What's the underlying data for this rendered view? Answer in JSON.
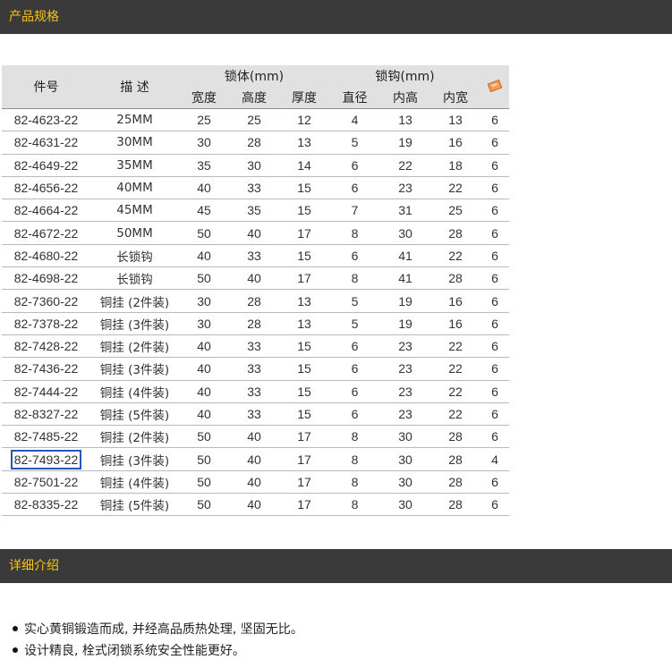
{
  "sections": {
    "spec_title": "产品规格",
    "detail_title": "详细介绍"
  },
  "table": {
    "headers": {
      "part_no": "件号",
      "desc": "描 述",
      "lock_body": "锁体(mm)",
      "shackle": "锁钩(mm)",
      "width": "宽度",
      "height": "高度",
      "thickness": "厚度",
      "diameter": "直径",
      "inner_height": "内高",
      "inner_width": "内宽",
      "pack_icon": "box-icon"
    },
    "rows": [
      [
        "82-4623-22",
        "25MM",
        "25",
        "25",
        "12",
        "4",
        "13",
        "13",
        "6"
      ],
      [
        "82-4631-22",
        "30MM",
        "30",
        "28",
        "13",
        "5",
        "19",
        "16",
        "6"
      ],
      [
        "82-4649-22",
        "35MM",
        "35",
        "30",
        "14",
        "6",
        "22",
        "18",
        "6"
      ],
      [
        "82-4656-22",
        "40MM",
        "40",
        "33",
        "15",
        "6",
        "23",
        "22",
        "6"
      ],
      [
        "82-4664-22",
        "45MM",
        "45",
        "35",
        "15",
        "7",
        "31",
        "25",
        "6"
      ],
      [
        "82-4672-22",
        "50MM",
        "50",
        "40",
        "17",
        "8",
        "30",
        "28",
        "6"
      ],
      [
        "82-4680-22",
        "长锁钩",
        "40",
        "33",
        "15",
        "6",
        "41",
        "22",
        "6"
      ],
      [
        "82-4698-22",
        "长锁钩",
        "50",
        "40",
        "17",
        "8",
        "41",
        "28",
        "6"
      ],
      [
        "82-7360-22",
        "铜挂 (2件装)",
        "30",
        "28",
        "13",
        "5",
        "19",
        "16",
        "6"
      ],
      [
        "82-7378-22",
        "铜挂 (3件装)",
        "30",
        "28",
        "13",
        "5",
        "19",
        "16",
        "6"
      ],
      [
        "82-7428-22",
        "铜挂 (2件装)",
        "40",
        "33",
        "15",
        "6",
        "23",
        "22",
        "6"
      ],
      [
        "82-7436-22",
        "铜挂 (3件装)",
        "40",
        "33",
        "15",
        "6",
        "23",
        "22",
        "6"
      ],
      [
        "82-7444-22",
        "铜挂 (4件装)",
        "40",
        "33",
        "15",
        "6",
        "23",
        "22",
        "6"
      ],
      [
        "82-8327-22",
        "铜挂 (5件装)",
        "40",
        "33",
        "15",
        "6",
        "23",
        "22",
        "6"
      ],
      [
        "82-7485-22",
        "铜挂 (2件装)",
        "50",
        "40",
        "17",
        "8",
        "30",
        "28",
        "6"
      ],
      [
        "82-7493-22",
        "铜挂 (3件装)",
        "50",
        "40",
        "17",
        "8",
        "30",
        "28",
        "4"
      ],
      [
        "82-7501-22",
        "铜挂 (4件装)",
        "50",
        "40",
        "17",
        "8",
        "30",
        "28",
        "6"
      ],
      [
        "82-8335-22",
        "铜挂 (5件装)",
        "50",
        "40",
        "17",
        "8",
        "30",
        "28",
        "6"
      ]
    ],
    "highlighted_part": "82-7493-22"
  },
  "features": [
    "实心黄铜锻造而成, 并经高品质热处理, 坚固无比。",
    "设计精良, 栓式闭锁系统安全性能更好。"
  ],
  "colors": {
    "section_bar_bg": "#3a3a3a",
    "section_title": "#f5c21a",
    "header_bg": "#e1e1e1",
    "highlight_border": "#2a55b5"
  }
}
